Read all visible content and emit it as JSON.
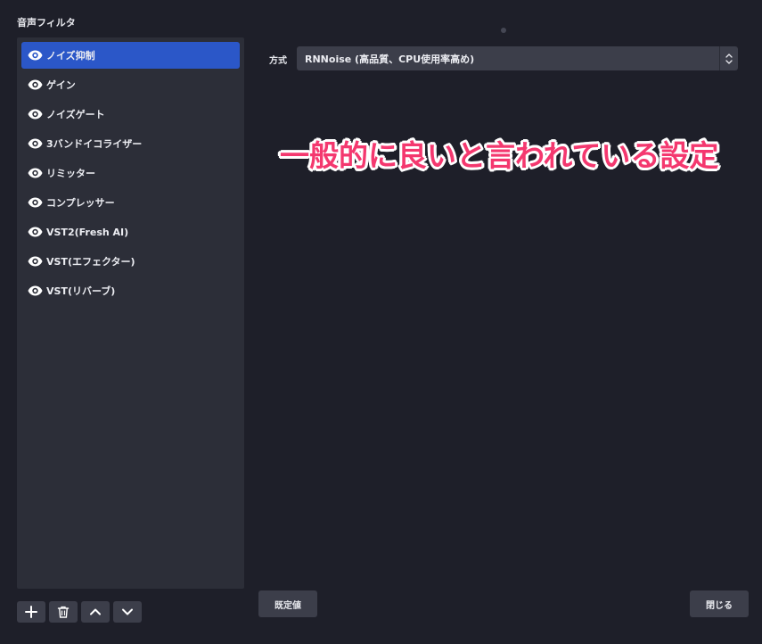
{
  "window": {
    "section_title": "音声フィルタ"
  },
  "filters": [
    {
      "label": "ノイズ抑制",
      "selected": true
    },
    {
      "label": "ゲイン",
      "selected": false
    },
    {
      "label": "ノイズゲート",
      "selected": false
    },
    {
      "label": "3バンドイコライザー",
      "selected": false
    },
    {
      "label": "リミッター",
      "selected": false
    },
    {
      "label": "コンプレッサー",
      "selected": false
    },
    {
      "label": "VST2(Fresh AI)",
      "selected": false
    },
    {
      "label": "VST(エフェクター)",
      "selected": false
    },
    {
      "label": "VST(リバーブ)",
      "selected": false
    }
  ],
  "toolbar": {
    "add_icon": "plus-icon",
    "remove_icon": "trash-icon",
    "move_up_icon": "chevron-up-icon",
    "move_down_icon": "chevron-down-icon"
  },
  "settings": {
    "method_label": "方式",
    "method_value": "RNNoise (高品質、CPU使用率高め)"
  },
  "annotation": {
    "text": "一般的に良いと言われている設定",
    "color": "#f4386f"
  },
  "buttons": {
    "defaults_label": "既定値",
    "close_label": "閉じる"
  },
  "colors": {
    "background": "#1e1f29",
    "panel": "#2c2e38",
    "selected": "#2b57c8",
    "button": "#3c3e4a"
  }
}
